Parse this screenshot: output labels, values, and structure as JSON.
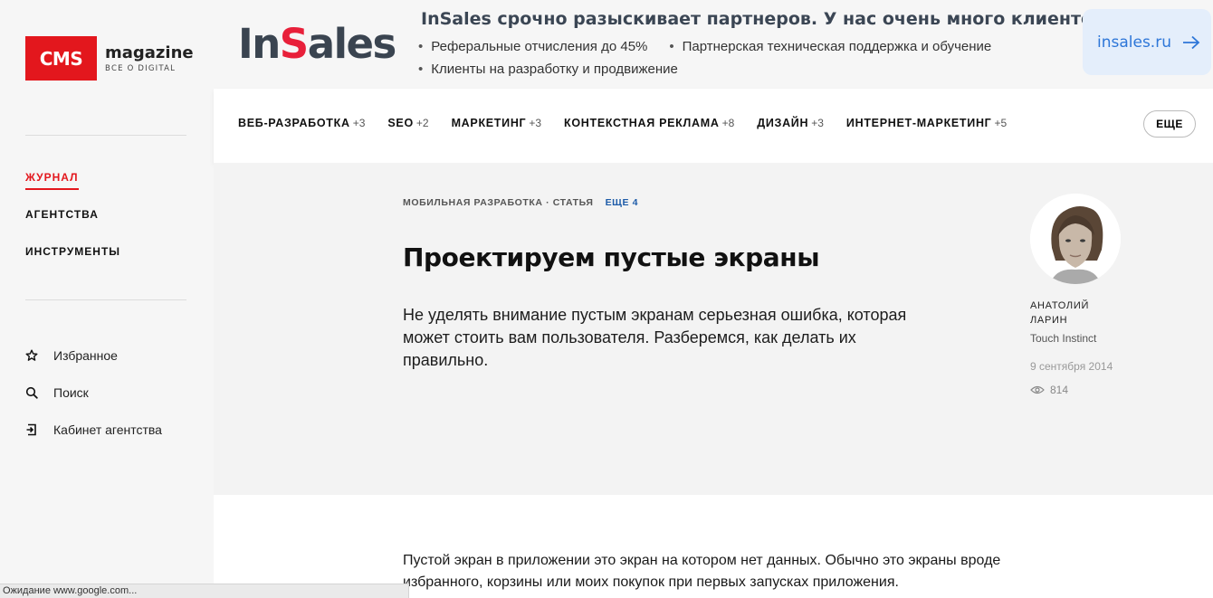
{
  "sidebar": {
    "logo": {
      "badge": "CMS",
      "word": "magazine",
      "tagline": "ВСЕ О DIGITAL"
    },
    "nav": [
      {
        "label": "ЖУРНАЛ"
      },
      {
        "label": "АГЕНТСТВА"
      },
      {
        "label": "ИНСТРУМЕНТЫ"
      }
    ],
    "links": [
      {
        "label": "Избранное",
        "icon": "star-icon"
      },
      {
        "label": "Поиск",
        "icon": "search-icon"
      },
      {
        "label": "Кабинет агентства",
        "icon": "login-icon"
      }
    ],
    "colors": {
      "accent": "#e3171d",
      "background": "#f6f6f6"
    }
  },
  "banner": {
    "logo_prefix": "In",
    "logo_accent": "S",
    "logo_suffix": "ales",
    "title": "InSales срочно разыскивает партнеров. У нас очень много клиентов",
    "bullets": [
      "Реферальные отчисления до 45%",
      "Партнерская техническая поддержка и обучение",
      "Клиенты на разработку и продвижение"
    ],
    "button_label": "insales.ru",
    "button_icon": "arrow-right-icon",
    "colors": {
      "logo_text": "#3a4450",
      "logo_accent": "#e8203a",
      "button_bg": "#e4eefb",
      "button_text": "#2d76d8"
    }
  },
  "catnav": {
    "items": [
      {
        "label": "ВЕБ-РАЗРАБОТКА",
        "count": "+3"
      },
      {
        "label": "SEO",
        "count": "+2"
      },
      {
        "label": "МАРКЕТИНГ",
        "count": "+3"
      },
      {
        "label": "КОНТЕКСТНАЯ РЕКЛАМА",
        "count": "+8"
      },
      {
        "label": "ДИЗАЙН",
        "count": "+3"
      },
      {
        "label": "ИНТЕРНЕТ-МАРКЕТИНГ",
        "count": "+5"
      }
    ],
    "more_label": "ЕЩЕ"
  },
  "article": {
    "meta": "МОБИЛЬНАЯ РАЗРАБОТКА · СТАТЬЯ",
    "more_tags": "ЕЩЕ 4",
    "title": "Проектируем пустые экраны",
    "lead": "Не уделять внимание пустым экранам серьезная ошибка, которая может стоить вам пользователя. Разберемся, как делать их правильно.",
    "body": "Пустой экран в приложении это экран на котором нет данных. Обычно это экраны вроде избранного, корзины или моих покупок при первых запусках приложения."
  },
  "author": {
    "name": "АНАТОЛИЙ ЛАРИН",
    "company": "Touch Instinct",
    "date": "9 сентября 2014",
    "views": "814",
    "views_icon": "eye-icon"
  },
  "statusbar": {
    "text": "Ожидание www.google.com..."
  }
}
